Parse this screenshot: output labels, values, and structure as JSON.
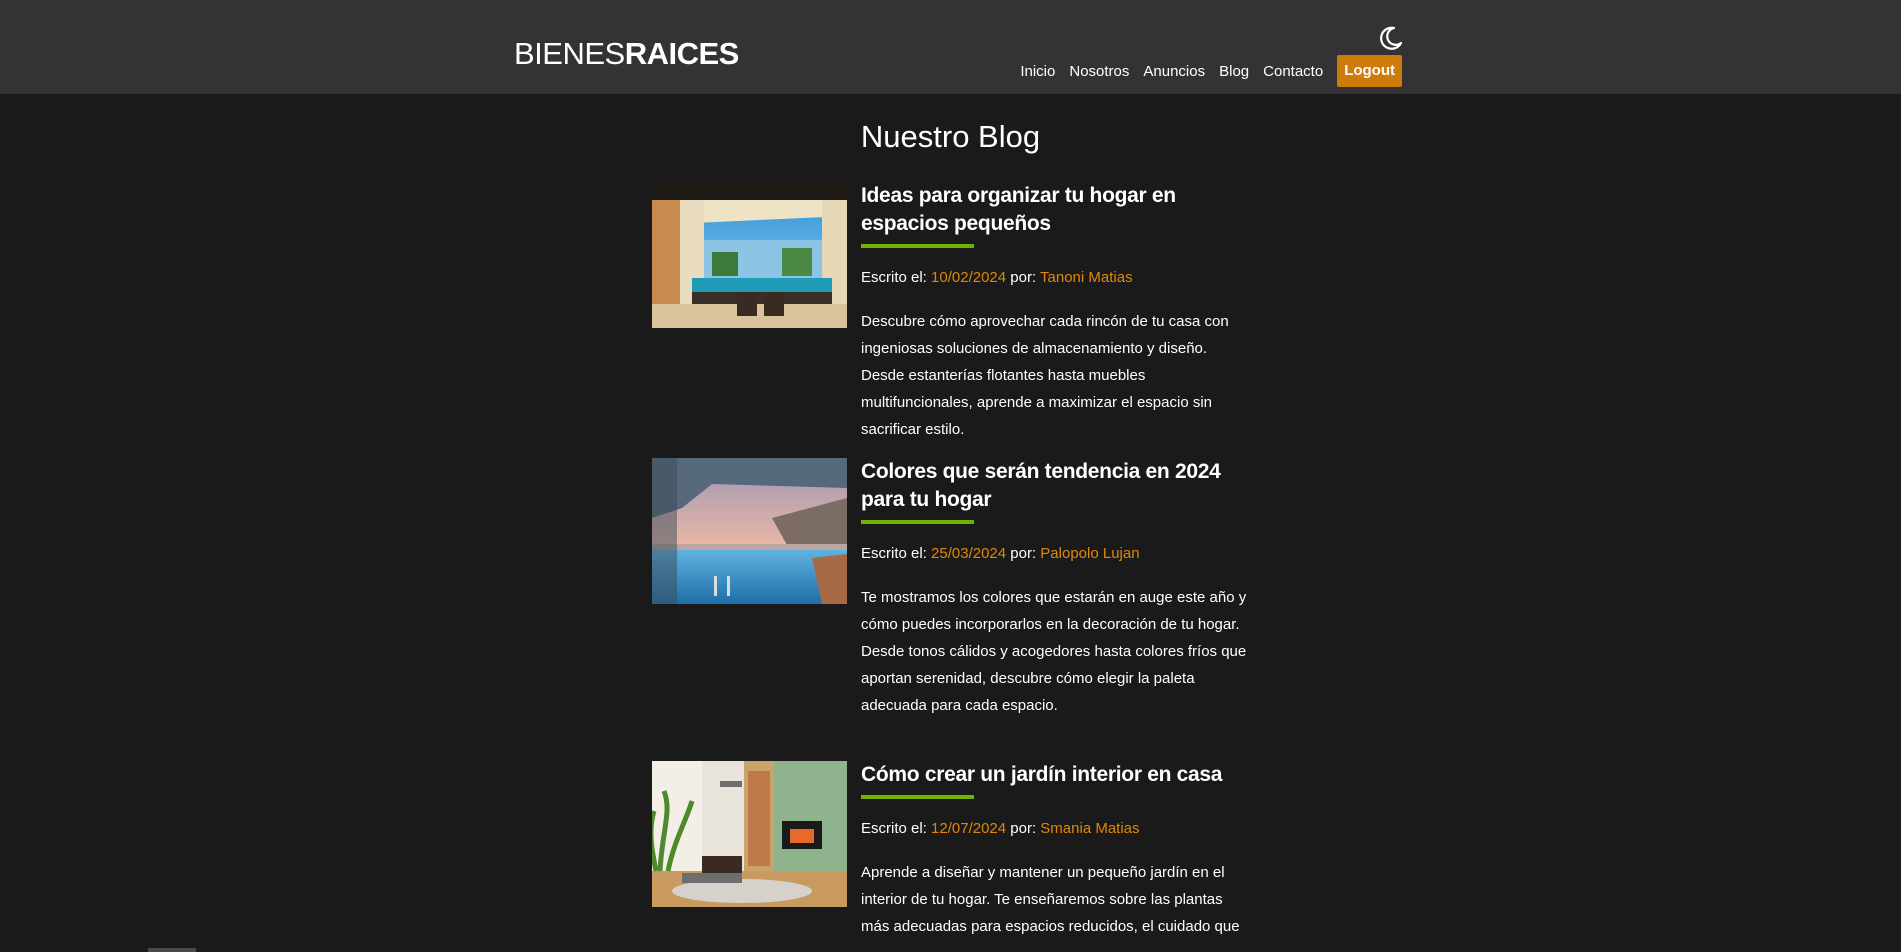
{
  "header": {
    "logo_light": "BIENES",
    "logo_bold": "RAICES",
    "theme_icon": "moon-icon",
    "nav": [
      {
        "label": "Inicio"
      },
      {
        "label": "Nosotros"
      },
      {
        "label": "Anuncios"
      },
      {
        "label": "Blog"
      },
      {
        "label": "Contacto"
      }
    ],
    "logout_label": "Logout"
  },
  "main": {
    "title": "Nuestro Blog",
    "posts": [
      {
        "title": "Ideas para organizar tu hogar en espacios pequeños",
        "meta_prefix": "Escrito el: ",
        "date": "10/02/2024",
        "by_label": " por: ",
        "author": "Tanoni Matias",
        "excerpt": "Descubre cómo aprovechar cada rincón de tu casa con ingeniosas soluciones de almacenamiento y diseño. Desde estanterías flotantes hasta muebles multifuncionales, aprende a maximizar el espacio sin sacrificar estilo."
      },
      {
        "title": "Colores que serán tendencia en 2024 para tu hogar",
        "meta_prefix": "Escrito el: ",
        "date": "25/03/2024",
        "by_label": " por: ",
        "author": "Palopolo Lujan",
        "excerpt": "Te mostramos los colores que estarán en auge este año y cómo puedes incorporarlos en la decoración de tu hogar. Desde tonos cálidos y acogedores hasta colores fríos que aportan serenidad, descubre cómo elegir la paleta adecuada para cada espacio."
      },
      {
        "title": "Cómo crear un jardín interior en casa",
        "meta_prefix": "Escrito el: ",
        "date": "12/07/2024",
        "by_label": " por: ",
        "author": "Smania Matias",
        "excerpt": "Aprende a diseñar y mantener un pequeño jardín en el interior de tu hogar. Te enseñaremos sobre las plantas más adecuadas para espacios reducidos, el cuidado que"
      }
    ]
  },
  "colors": {
    "header_bg": "#333333",
    "page_bg": "#1a1a1a",
    "accent_orange": "#e08709",
    "accent_green": "#71b100"
  }
}
